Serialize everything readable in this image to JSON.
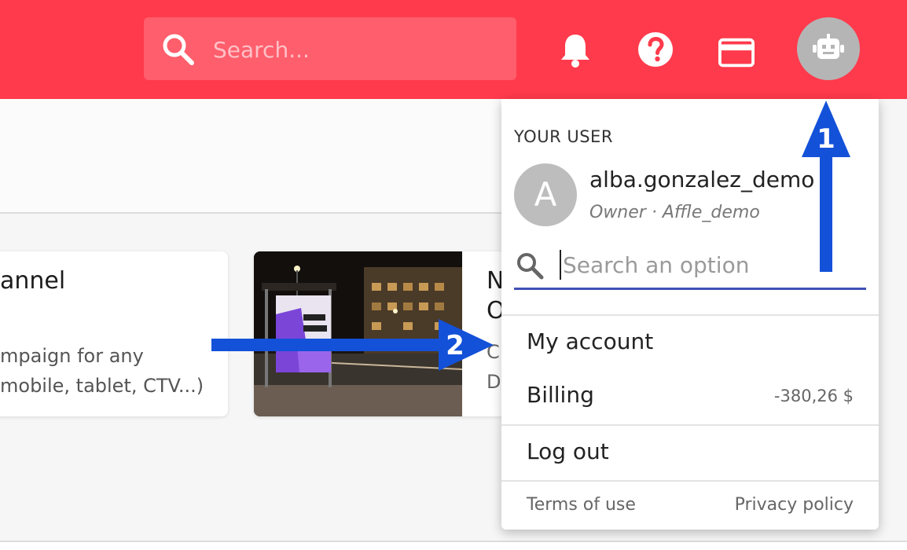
{
  "topbar": {
    "search_placeholder": "Search...",
    "icons": [
      "search-icon",
      "bell-icon",
      "help-icon",
      "credit-card-icon",
      "robot-icon"
    ],
    "bg_color": "#ff3a4c"
  },
  "cards": [
    {
      "title": "annel",
      "description_lines": [
        "mpaign for any",
        "mobile, tablet, CTV...)"
      ]
    },
    {
      "image": "bus-stop-billboard-photo",
      "title_lines": [
        "N",
        "O"
      ],
      "description_lines": [
        "C",
        "D"
      ]
    }
  ],
  "dropdown": {
    "heading": "YOUR USER",
    "avatar_letter": "A",
    "username": "alba.gonzalez_demo",
    "role": "Owner · Affle_demo",
    "search_placeholder": "Search an option",
    "items": [
      {
        "label": "My account",
        "value": ""
      },
      {
        "label": "Billing",
        "value": "-380,26 $"
      },
      {
        "label": "Log out",
        "value": ""
      }
    ],
    "footer": {
      "terms": "Terms of use",
      "privacy": "Privacy policy"
    },
    "accent_color": "#3f51b5"
  },
  "annotations": [
    {
      "label": "1",
      "color": "#1351d8"
    },
    {
      "label": "2",
      "color": "#1351d8"
    }
  ]
}
